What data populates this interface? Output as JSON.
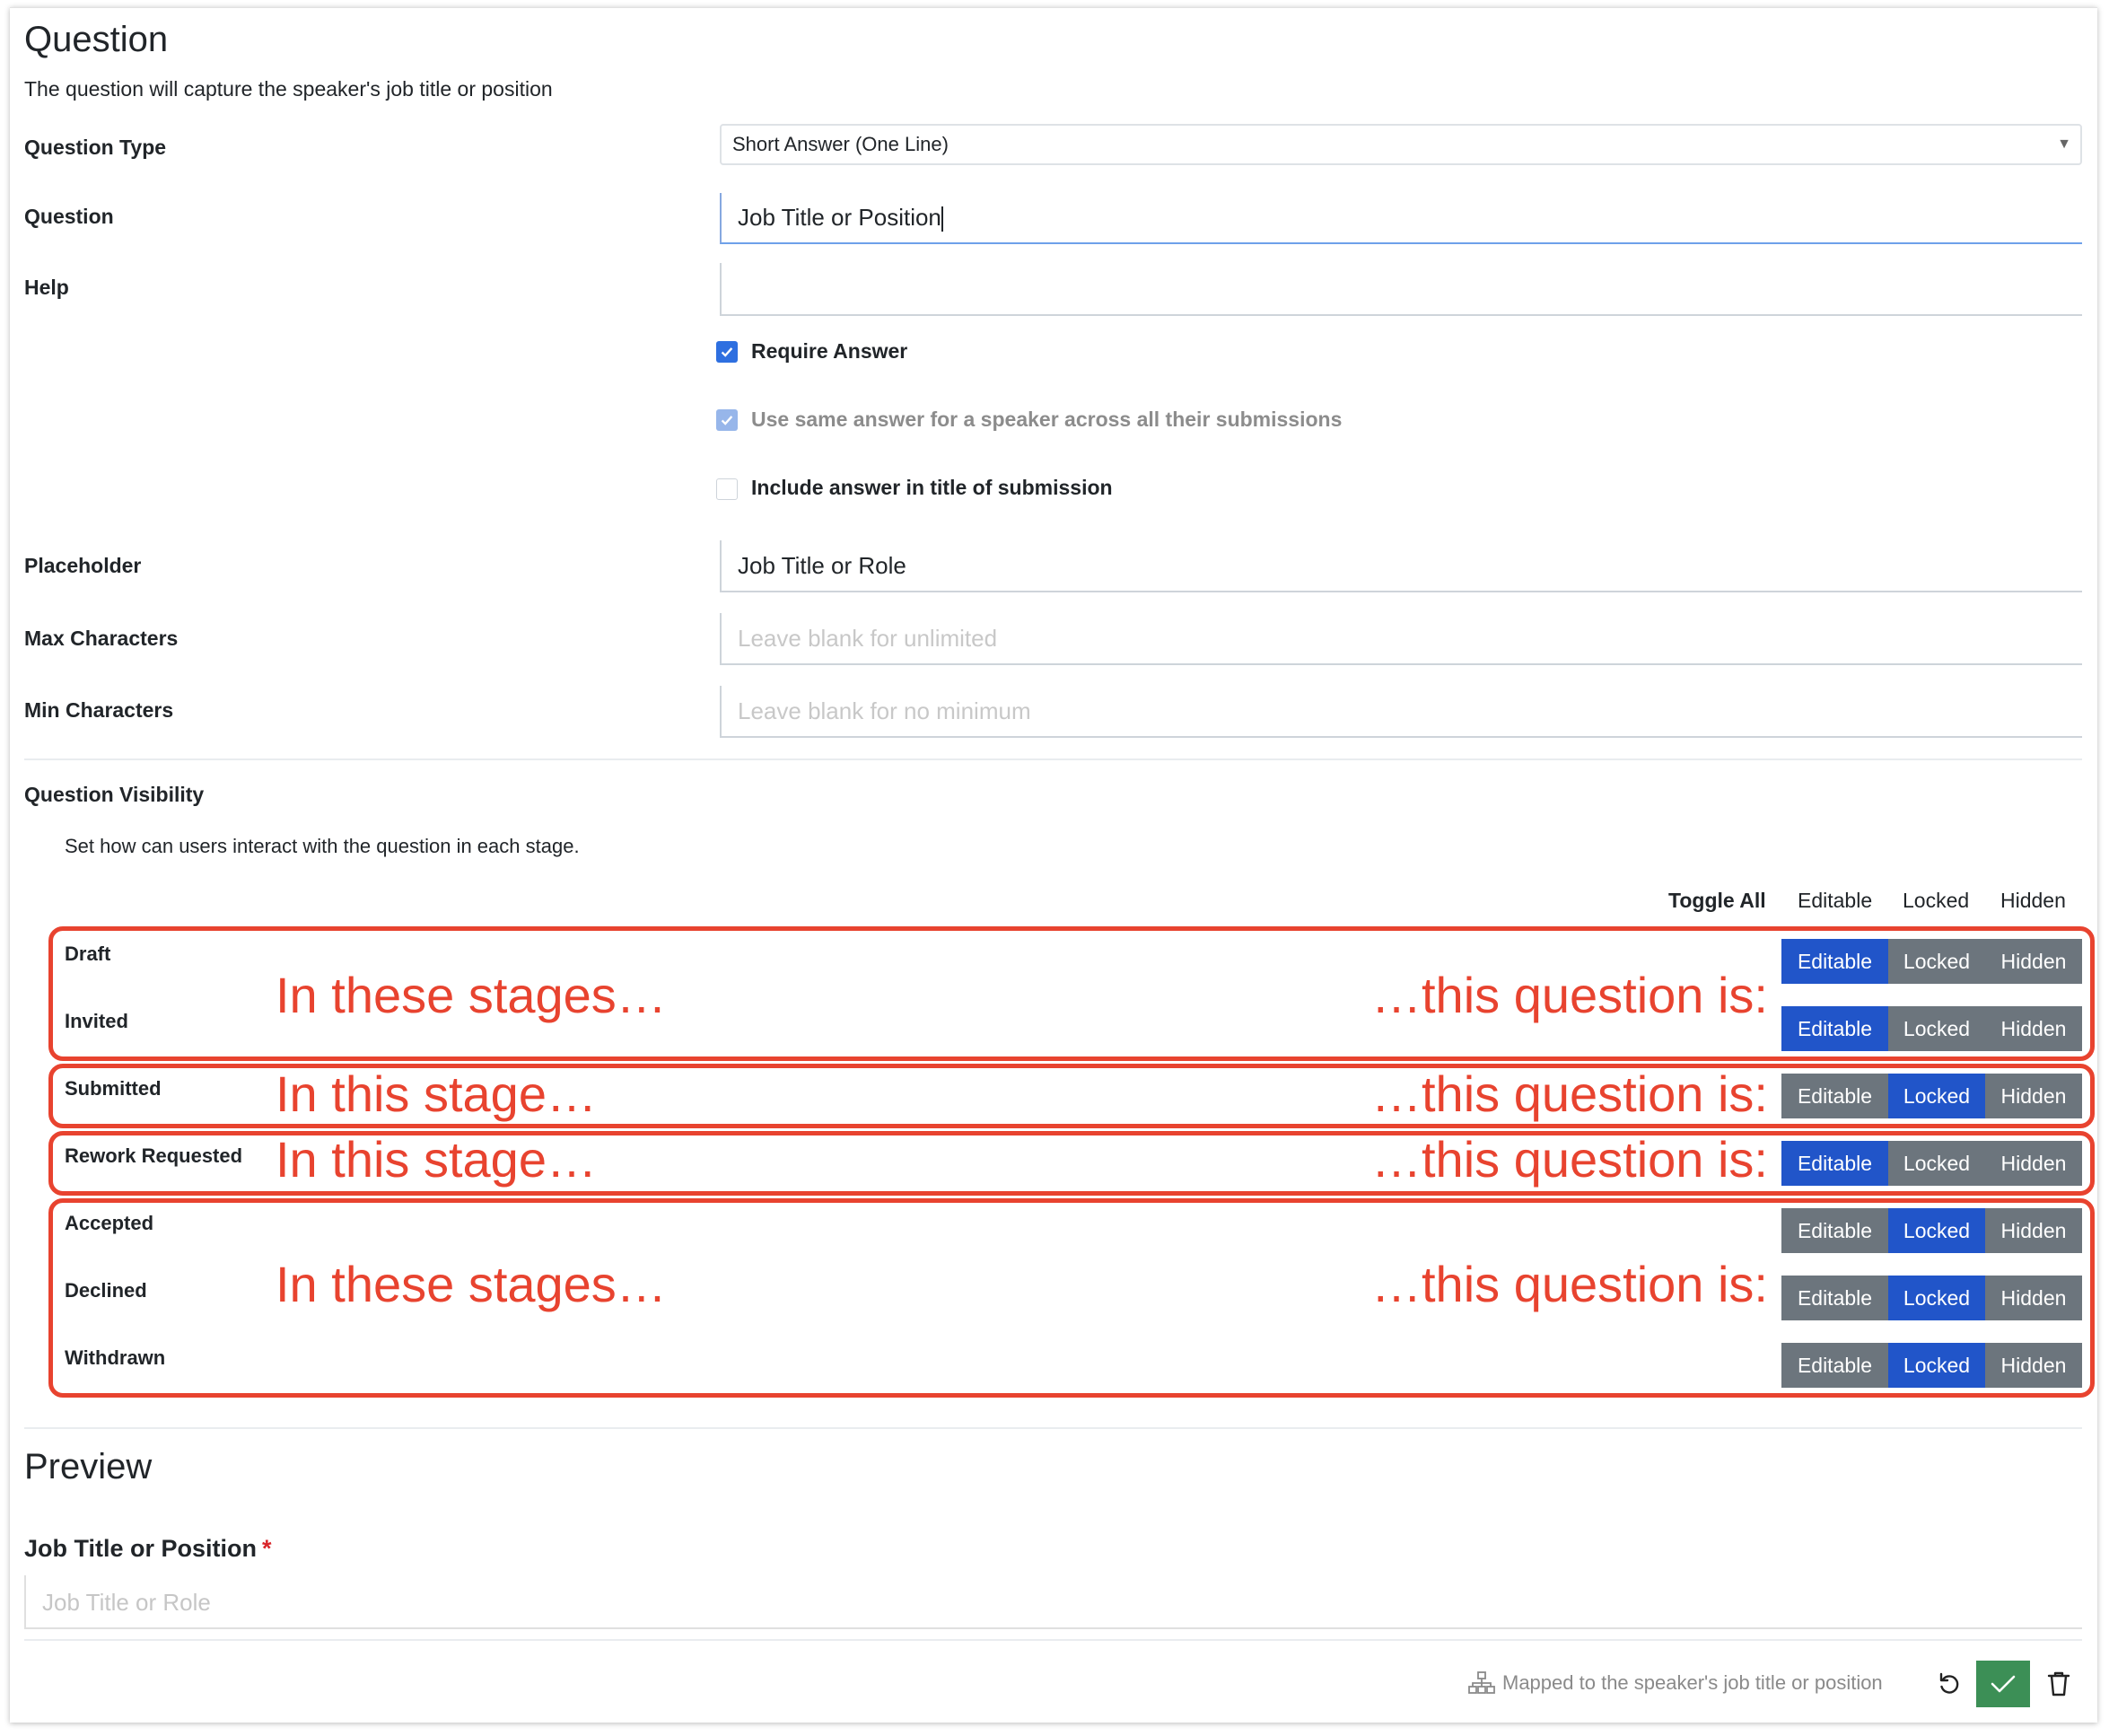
{
  "question": {
    "title": "Question",
    "description": "The question will capture the speaker's job title or position"
  },
  "form": {
    "type_label": "Question Type",
    "type_value": "Short Answer (One Line)",
    "question_label": "Question",
    "question_value": "Job Title or Position",
    "help_label": "Help",
    "help_value": "",
    "checkboxes": [
      {
        "label": "Require Answer",
        "checked": true
      },
      {
        "label": "Use same answer for a speaker across all their submissions",
        "checked": true,
        "disabled": true
      },
      {
        "label": "Include answer in title of submission",
        "checked": false
      }
    ],
    "placeholder_label": "Placeholder",
    "placeholder_value": "Job Title or Role",
    "max_label": "Max Characters",
    "max_placeholder": "Leave blank for unlimited",
    "min_label": "Min Characters",
    "min_placeholder": "Leave blank for no minimum"
  },
  "visibility": {
    "title": "Question Visibility",
    "description": "Set how can users interact with the question in each stage.",
    "toggle_all": "Toggle All",
    "options": [
      "Editable",
      "Locked",
      "Hidden"
    ],
    "stages": [
      {
        "name": "Draft",
        "selected": "Editable"
      },
      {
        "name": "Invited",
        "selected": "Editable"
      },
      {
        "name": "Submitted",
        "selected": "Locked"
      },
      {
        "name": "Rework Requested",
        "selected": "Editable"
      },
      {
        "name": "Accepted",
        "selected": "Locked"
      },
      {
        "name": "Declined",
        "selected": "Locked"
      },
      {
        "name": "Withdrawn",
        "selected": "Locked"
      }
    ]
  },
  "annotations": {
    "color": "#e8432f",
    "plural_left": "In these stages…",
    "singular_left": "In this stage…",
    "right": "…this question is:"
  },
  "preview": {
    "title": "Preview",
    "label": "Job Title or Position",
    "required_mark": "*",
    "placeholder": "Job Title or Role"
  },
  "footer": {
    "mapped_text": "Mapped to the speaker's job title or position",
    "icons": [
      "hierarchy-icon",
      "undo-icon",
      "check-icon",
      "trash-icon"
    ],
    "confirm_color": "#3c8f56"
  }
}
